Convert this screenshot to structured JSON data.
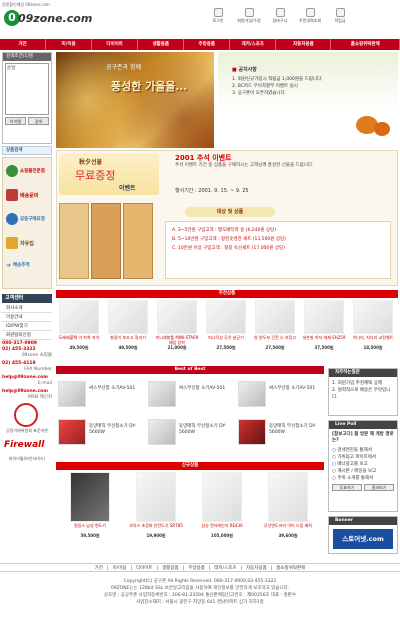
{
  "header": {
    "tagline": "정말할인매장 09zone.com",
    "logo_text": "09zone.com",
    "util": [
      "로그인",
      "회원가입/수정",
      "장바구니",
      "주문내역조회",
      "적립금"
    ]
  },
  "nav": [
    "가전",
    "미/미용",
    "다이어트",
    "생활용품",
    "주방용품",
    "레저/스포츠",
    "자동차용품",
    "홈쇼핑위탁판매"
  ],
  "left": {
    "search_label": "검색조건(1)명",
    "search_value": "순일",
    "btn1": "아이템",
    "btn2": "검색",
    "cat_title": "상품검색",
    "cats": [
      "쇼핑몰전문점",
      "베송문의",
      "공동구매요청",
      "자유집",
      "배송추적"
    ],
    "service_title": "고객센터",
    "service": [
      "회사소개",
      "이용안내",
      "ID/PW찾기",
      "회원탈퇴신청"
    ],
    "phone1": "080-317-0909",
    "phone2": "02) 455-3322",
    "site": "09zone 쇼핑몰",
    "fax": "02) 455-4118",
    "fax_label": "FAX Number",
    "email": "help@09zone.com",
    "email_label": "E-mail",
    "msn": "help@09zone.com",
    "msn_label": "MSN 메신저",
    "seal": "공정거래위원회 표준약관",
    "firewall": "Firewall",
    "fw_label": "파이어월(보안서비스)"
  },
  "banner": {
    "line1": "공구존과 함께",
    "line2": "풍성한 가을을..."
  },
  "notice": {
    "title": "공지사항",
    "items": [
      "1. 회원신규가입시 적립금 1,000원을 드립니다.",
      "2. BC카드 무이자할부 이벤트 실시",
      "3. 공구존이 오픈하였습니다."
    ]
  },
  "event": {
    "kicker": "秋夕선물",
    "title": "무료증정",
    "tag": "이벤트",
    "head": "2001 추석 이벤트",
    "desc": "추석 이벤트 기간 중 상품을 구매하시는 고객님께 풍성한 선물을 드립니다.",
    "period": "행사기간 : 2001. 9. 15. ~ 9. 25",
    "target": "대상 및 상품",
    "rules": [
      "A. 3~5만원 구입고객 : 평도배터라 송 (6,240원 상당)",
      "B. 5~10만원 구입고객 : 핑킹솟영관 세트 (13,500원 상당)",
      "C. 10만원 이상 구입고객 : 핑칭 옥선세트 (17,000원 상당)"
    ]
  },
  "recommend": {
    "title": "추천상품",
    "items": [
      {
        "name": "도배배풀팩 이 착착 자석",
        "price": "49,500원"
      },
      {
        "name": "향광이 보조고 정리기",
        "price": "49,500원"
      },
      {
        "name": "미니재봉틀 MINI-STAR9 매입 장착",
        "price": "21,000원"
      },
      {
        "name": "미니탁상 무선 살균기",
        "price": "27,500원"
      },
      {
        "name": "원 원두보 건전 오 저장고",
        "price": "27,500원"
      },
      {
        "name": "내손발 허자 체제 EH259",
        "price": "37,500원"
      },
      {
        "name": "이다리, 지다리 교정벨트",
        "price": "18,500원"
      }
    ]
  },
  "best": {
    "title": "Best of Best",
    "items": [
      {
        "name": "싸스무선청 소기AV-501"
      },
      {
        "name": "싸스무선청 소기AV-501"
      },
      {
        "name": "싸스무선청 소기AV-501"
      },
      {
        "name": "동양매직 무선청소기 DY-5600W"
      },
      {
        "name": "동양매직 무선청소기 DY-5600W"
      },
      {
        "name": "동양매직 무선청소기 DY-5600W"
      }
    ]
  },
  "newp": {
    "title": "신규상품",
    "items": [
      {
        "name": "필립스 남성 면도기",
        "price": "59,500원"
      },
      {
        "name": "조아스 초음파 안전도기 SR785",
        "price": "19,900원"
      },
      {
        "name": "삼성 전자레인지 RE436",
        "price": "105,000원"
      },
      {
        "name": "무선면도프리 이어 드링 매직",
        "price": "39,600원"
      }
    ]
  },
  "right": {
    "rec_title": "자주하는질문",
    "rec": [
      "1. 회원가입 추천혜택 공제",
      "2. 원력적으로 배송은 무엇입니다."
    ],
    "poll_title": "Live Poll",
    "poll_q": "[참보고다] 몸 방문 해 개방 경로는?",
    "poll_opts": [
      "검색엔진을 통해서",
      "가위됩고 파이트에서",
      "배너광고를 보고",
      "계시판 / 메일을 보고",
      "주위 소개를 통해서"
    ],
    "poll_btn": "투표하기",
    "poll_res": "결과보기",
    "banner_title": "Banner",
    "banner_text": "스토어넷.com"
  },
  "footer": {
    "links": [
      "가전",
      "미/미용",
      "다이어트",
      "생활용품",
      "주방용품",
      "레저/스포츠",
      "자동차용품",
      "홈쇼핑위탁판매"
    ],
    "copy": "Copyright(C) 공구존 All Rights Reserved. 080-317-0909,02-455-3322",
    "l2": "09ZONE는는 128bit SSL 보안알고리즘을 사용하여 개인정보를 안전하게 보호하고 있습니다.",
    "l3": "상호명 : 공공주존 사업자등록번호 : 206-81-23594 통신판매업신고번호 : 제00356호 대표 : 홍판수",
    "l4": "사업장소재지 : 서울시 광진구 자양동 641 경남아파트 상가 지하1층"
  },
  "colors": {
    "red": "#c00018",
    "gold": "#d59a24",
    "navy": "#2a3c6e"
  }
}
